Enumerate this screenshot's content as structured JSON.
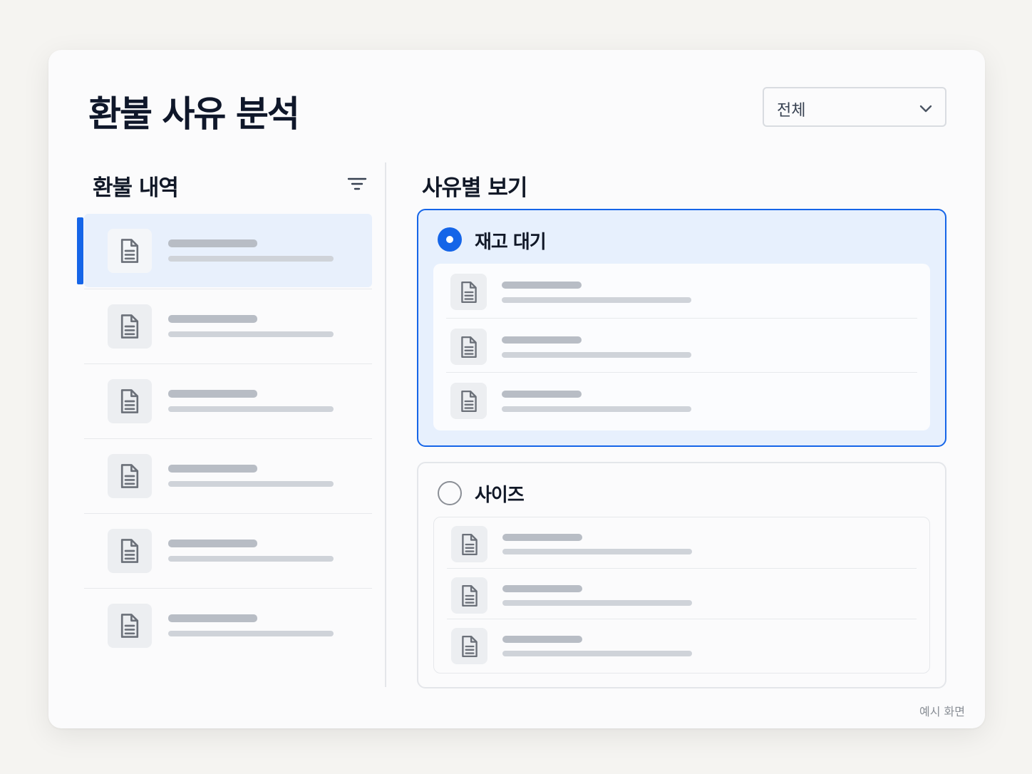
{
  "header": {
    "title": "환불 사유 분석",
    "filter_select": {
      "selected": "전체",
      "icon": "chevron-down-icon"
    }
  },
  "refund_history": {
    "title": "환불 내역",
    "filter_icon": "filter-icon",
    "item_count": 6,
    "selected_index": 0,
    "item_icon": "document-icon"
  },
  "reasons": {
    "title": "사유별 보기",
    "groups": [
      {
        "label": "재고 대기",
        "selected": true,
        "item_count": 3
      },
      {
        "label": "사이즈",
        "selected": false,
        "item_count": 3
      }
    ]
  },
  "footer": {
    "note": "예시 화면"
  },
  "colors": {
    "accent": "#1565e8",
    "selected_bg": "#e7f0fd",
    "page_bg": "#f5f4f1",
    "card_bg": "#fbfbfc",
    "skeleton_dark": "#b8bdc5",
    "skeleton_light": "#cfd3d9"
  }
}
